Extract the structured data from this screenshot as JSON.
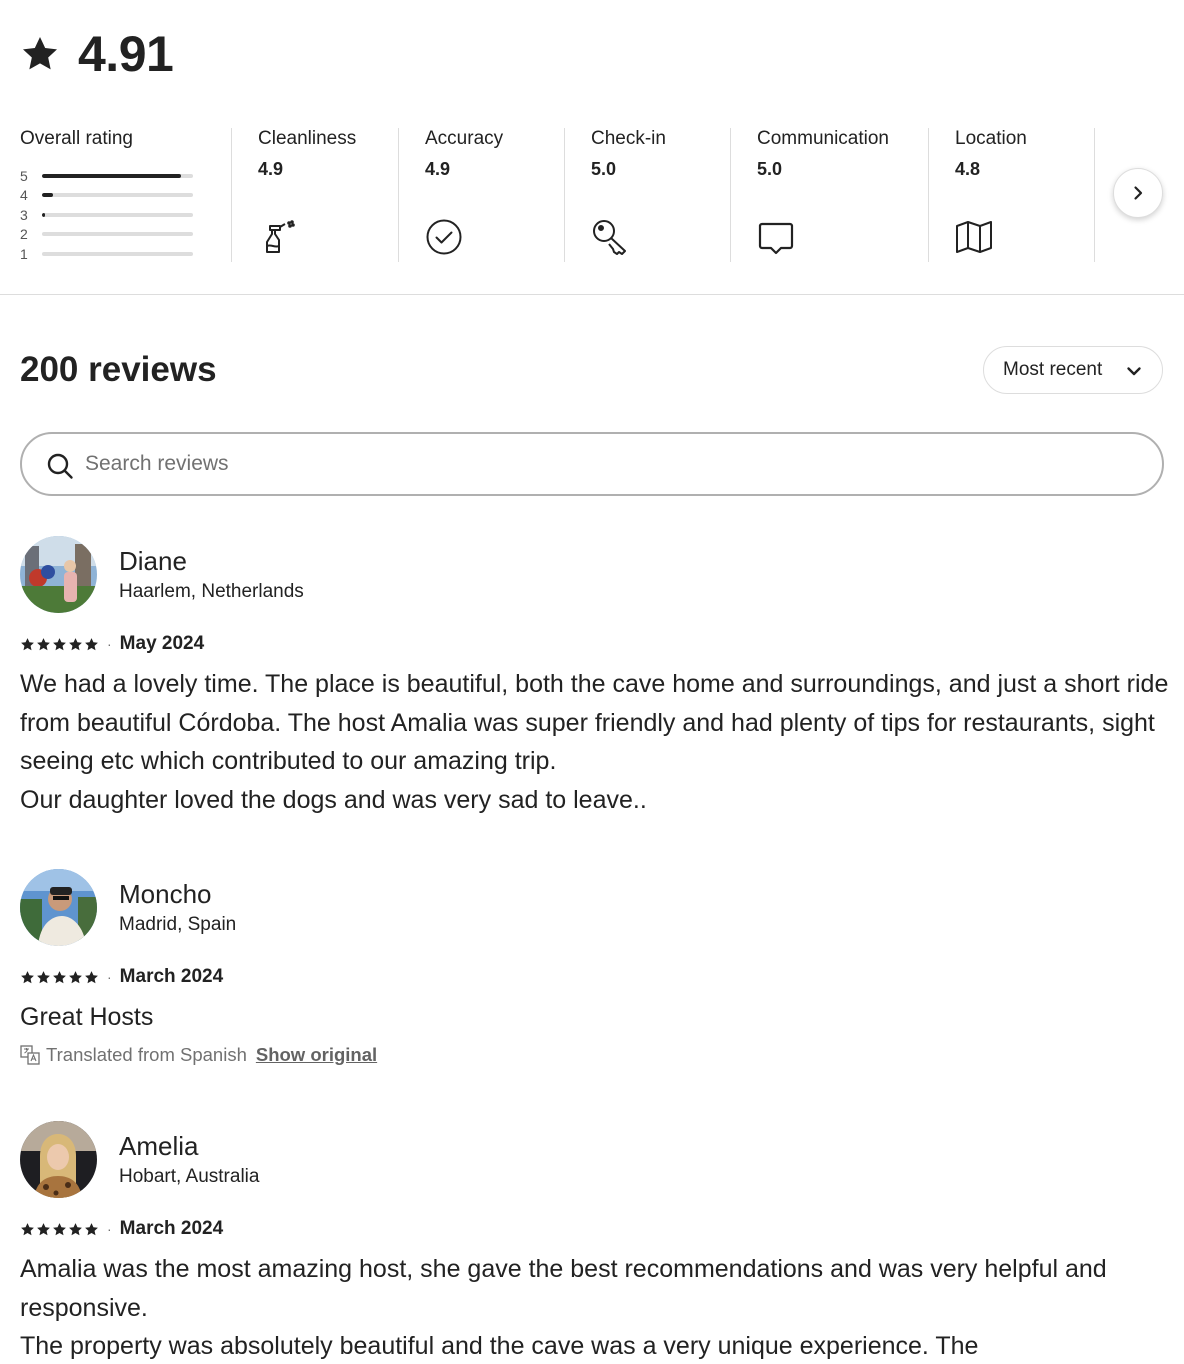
{
  "overall": {
    "score": "4.91",
    "icon": "star-icon"
  },
  "categories": {
    "overall_title": "Overall rating",
    "rating_bars": [
      {
        "label": "5",
        "fraction": 0.92
      },
      {
        "label": "4",
        "fraction": 0.07
      },
      {
        "label": "3",
        "fraction": 0.02
      },
      {
        "label": "2",
        "fraction": 0.0
      },
      {
        "label": "1",
        "fraction": 0.0
      }
    ],
    "items": [
      {
        "title": "Cleanliness",
        "value": "4.9",
        "icon": "spray-bottle-icon"
      },
      {
        "title": "Accuracy",
        "value": "4.9",
        "icon": "check-circle-icon"
      },
      {
        "title": "Check-in",
        "value": "5.0",
        "icon": "key-icon"
      },
      {
        "title": "Communication",
        "value": "5.0",
        "icon": "chat-bubble-icon"
      },
      {
        "title": "Location",
        "value": "4.8",
        "icon": "map-icon"
      }
    ],
    "next_icon": "chevron-right-icon"
  },
  "reviews_header": {
    "count_label": "200 reviews",
    "sort_label": "Most recent",
    "sort_icon": "chevron-down-icon"
  },
  "search": {
    "placeholder": "Search reviews",
    "value": "",
    "icon": "search-icon"
  },
  "reviews": [
    {
      "name": "Diane",
      "location": "Haarlem, Netherlands",
      "stars": 5,
      "date": "May 2024",
      "text": "We had a lovely time. The place is beautiful, both the cave home and surroundings, and just a short ride from beautiful Córdoba. The host Amalia was super friendly and had plenty of tips for restaurants, sight seeing etc which contributed to our amazing trip.\nOur daughter loved the dogs and was very sad to leave.."
    },
    {
      "name": "Moncho",
      "location": "Madrid, Spain",
      "stars": 5,
      "date": "March 2024",
      "text": "Great Hosts",
      "translated_label": "Translated from Spanish",
      "show_original_label": "Show original",
      "translate_icon": "translate-icon"
    },
    {
      "name": "Amelia",
      "location": "Hobart, Australia",
      "stars": 5,
      "date": "March 2024",
      "text": "Amalia was the most amazing host, she gave the best recommendations and was very helpful and responsive.\nThe property was absolutely beautiful and the cave was a very unique experience. The"
    }
  ],
  "colors": {
    "text": "#222222",
    "muted": "#717171",
    "border": "#dddddd"
  }
}
